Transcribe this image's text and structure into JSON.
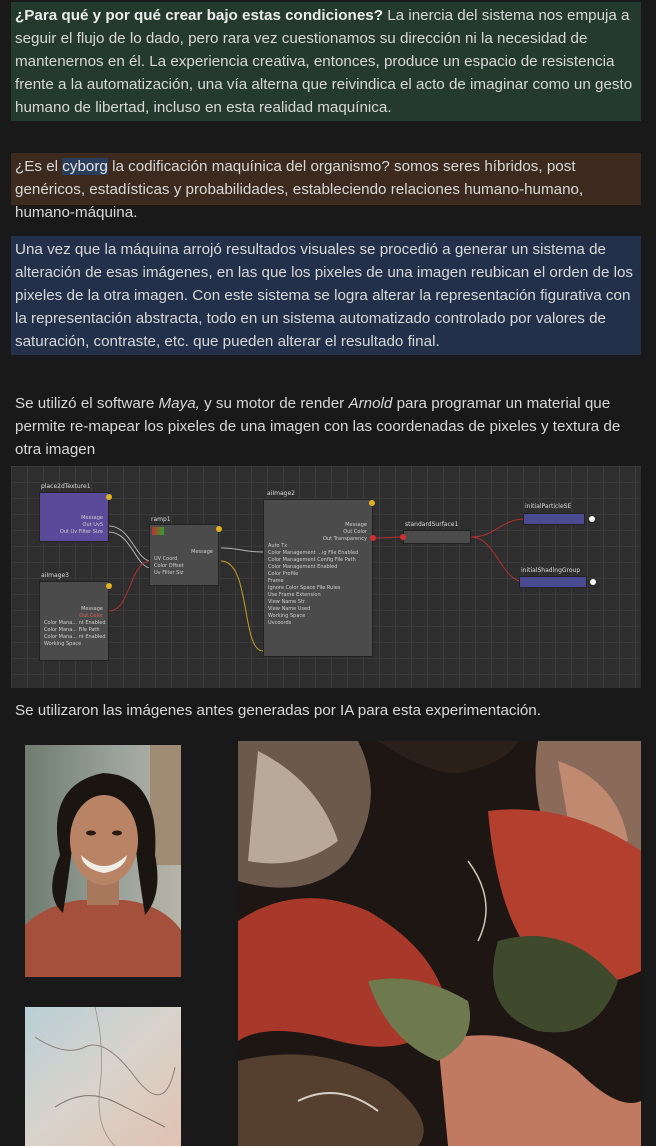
{
  "para1": {
    "bold": "¿Para qué y por qué crear bajo estas condiciones?",
    "text": " La inercia del sistema nos empuja a seguir el flujo de lo dado, pero rara vez cuestionamos su dirección ni la necesidad de mantenernos en él. La experiencia creativa, entonces, produce un espacio de resistencia frente a la automatización, una vía alterna que reivindica el acto de imaginar como un gesto humano de libertad, incluso en esta realidad maquínica."
  },
  "para2": {
    "before": "¿Es el ",
    "highlight": "cyborg",
    "after": " la codificación maquínica del organismo? somos seres híbridos, post genéricos, estadísticas y probabilidades, estableciendo relaciones humano-humano, humano-máquina."
  },
  "para3": "Una vez que la máquina arrojó resultados visuales se procedió a generar un sistema de alteración de esas imágenes, en las que los pixeles de una imagen reubican el orden de los pixeles de la otra imagen. Con este sistema se logra alterar la representación figurativa con la representación abstracta, todo en un sistema automatizado controlado por valores de saturación, contraste, etc. que pueden alterar el resultado final.",
  "para4": {
    "t1": "Se utilizó el software ",
    "maya": "Maya,",
    "t2": " y su motor de render ",
    "arnold": "Arnold",
    "t3": " para programar un material que permite re-mapear los pixeles de una imagen con las coordenadas de pixeles y textura de otra imagen"
  },
  "nodes": {
    "place2d": {
      "title": "place2dTexture1",
      "rows": [
        "Message",
        "Out UvS",
        "Out Uv Filter Size"
      ]
    },
    "ramp": {
      "title": "ramp1",
      "rows": [
        "Message",
        "UV Coord",
        "Color Offset",
        "Uv Filter Siz"
      ]
    },
    "aimage3": {
      "title": "aiImage3",
      "rows": [
        "Message",
        "Out Color",
        "Color Mana... nt Enabled",
        "Color Mana... File Path",
        "Color Mana... nt Enabled",
        "Working Space"
      ]
    },
    "aimage2": {
      "title": "aiImage2",
      "rows": [
        "Message",
        "Out Color",
        "Out Transparency",
        "Auto Tx",
        "Color Management ...ig File Enabled",
        "Color Management Config File Path",
        "Color Management Enabled",
        "Color Profile",
        "Frame",
        "Ignore Color Space File Rules",
        "Use Frame Extension",
        "View Name Str",
        "View Name Used",
        "Working Space",
        "Uvcoords"
      ]
    },
    "standard": {
      "title": "standardSurface1"
    },
    "particle": {
      "title": "initialParticleSE"
    },
    "shading": {
      "title": "initialShadingGroup"
    }
  },
  "para5": "Se utilizaron las imágenes antes generadas por IA para esta experimentación."
}
